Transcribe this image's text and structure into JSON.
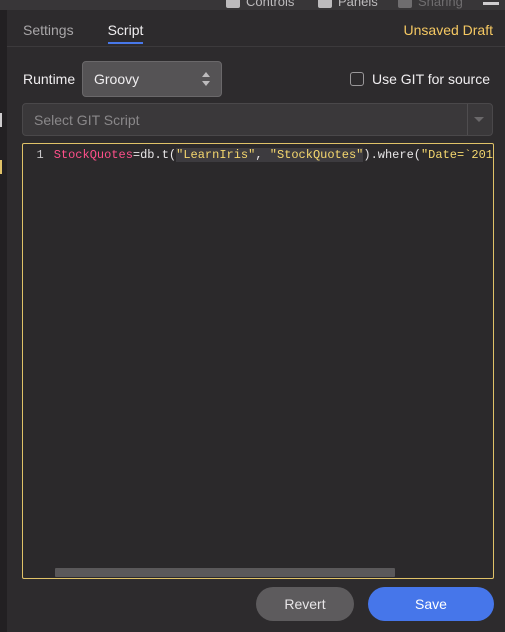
{
  "toolbar": {
    "items": [
      {
        "label": "Controls",
        "icon": "controls-icon"
      },
      {
        "label": "Panels",
        "icon": "panels-icon"
      },
      {
        "label": "Sharing",
        "icon": "share-icon"
      }
    ],
    "menu_icon": "hamburger-icon"
  },
  "tabs": [
    {
      "label": "Settings",
      "active": false
    },
    {
      "label": "Script",
      "active": true
    }
  ],
  "status": {
    "draft": "Unsaved Draft"
  },
  "runtime": {
    "label": "Runtime",
    "value": "Groovy"
  },
  "git": {
    "checkbox_label": "Use GIT for source",
    "checked": false,
    "select_placeholder": "Select GIT Script"
  },
  "editor": {
    "lines": [
      {
        "number": "1",
        "tokens": {
          "var": "StockQuotes",
          "t1": "=db.t(",
          "s1": "\"LearnIris\"",
          "t2": ", ",
          "s2": "\"StockQuotes\"",
          "t3": ").where(",
          "s3": "\"Date=`201"
        }
      }
    ]
  },
  "actions": {
    "revert": "Revert",
    "save": "Save"
  },
  "colors": {
    "accent": "#4676ea",
    "draft": "#f5c862",
    "editor_border": "#e0c268"
  }
}
